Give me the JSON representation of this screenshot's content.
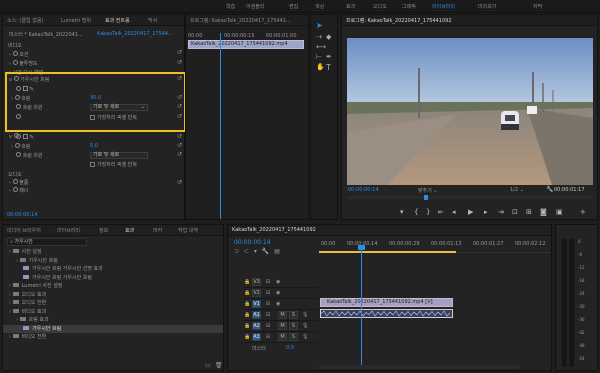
{
  "menu": {
    "items": [
      "학습",
      "어셈블리",
      "편집",
      "색상",
      "효과",
      "오디오",
      "그래픽",
      "라이브러리",
      "미리보기",
      "자막"
    ],
    "active_index": 7
  },
  "effects_panel": {
    "tabs": [
      "소스: (클립 없음)",
      "Lumetri 범위",
      "효과 컨트롤",
      "믹서"
    ],
    "active_tab": 2,
    "clip_label": "마스터 * KakaoTalk_2022041...",
    "clip_name": "KakaoTalk_20220417_17544...",
    "timecode": "00:00:00:14",
    "sections": [
      {
        "label": "비디오"
      },
      {
        "label": "모션"
      },
      {
        "label": "불투명도"
      },
      {
        "label": "시간 다시 매핑"
      }
    ],
    "gaussian": {
      "title": "가우시안 흐림",
      "blur_label": "흐림",
      "blur_value": "30.0",
      "dim_label": "흐림 차원",
      "dim_value": "가로 및 세로",
      "repeat_label": "가장자리 픽셀 반복"
    },
    "mosaic": {
      "blur_label": "흐림",
      "blur_value": "0.0",
      "dim_label": "흐림 차원",
      "dim_value": "가로 및 세로",
      "repeat_label": "가장자리 픽셀 반복"
    },
    "audio_section": "오디오",
    "audio_items": [
      "볼륨",
      "패너"
    ]
  },
  "source_panel": {
    "tab": "프로그램: KakaoTalk_20220417_175441...",
    "ruler": [
      "00:00",
      "00:00:00:15",
      "00:00:01:00"
    ],
    "clip": "KakaoTalk_20220417_175441092.mp4"
  },
  "program": {
    "tab": "프로그램: KakaoTalk_20220417_175441092",
    "timecode_left": "00:00:00:14",
    "fit": "맞추기",
    "quality": "1/2",
    "timecode_right": "00:00:01:17"
  },
  "project_panel": {
    "tabs": [
      "미디어 브라우저",
      "라이브러리",
      "정보",
      "효과",
      "마커",
      "작업 내역"
    ],
    "active_tab": 3,
    "search_placeholder": "가우시안",
    "tree": [
      {
        "label": "사전 설정",
        "indent": 0,
        "icon": "folder"
      },
      {
        "label": "가우시안 흐림",
        "indent": 1,
        "icon": "folder"
      },
      {
        "label": "가우시안 흐림 가우시안 선명 효과",
        "indent": 2,
        "icon": "effect"
      },
      {
        "label": "가우시안 흐림 가우시안 흐림",
        "indent": 2,
        "icon": "effect"
      },
      {
        "label": "Lumetri 사전 설정",
        "indent": 0,
        "icon": "folder"
      },
      {
        "label": "오디오 효과",
        "indent": 0,
        "icon": "folder"
      },
      {
        "label": "오디오 전환",
        "indent": 0,
        "icon": "folder"
      },
      {
        "label": "비디오 효과",
        "indent": 0,
        "icon": "folder"
      },
      {
        "label": "흐림 효과",
        "indent": 1,
        "icon": "folder"
      },
      {
        "label": "가우시안 흐림",
        "indent": 2,
        "icon": "effect",
        "selected": true
      },
      {
        "label": "비디오 전환",
        "indent": 0,
        "icon": "folder"
      }
    ]
  },
  "timeline": {
    "tab": "KakaoTalk_20220417_175441092",
    "timecode": "00:00:00:14",
    "ruler": [
      "00:00",
      "00:00:00:14",
      "00:00:00:29",
      "00:00:01:13",
      "00:00:01:27",
      "00:00:02:12"
    ],
    "video_tracks": [
      "V3",
      "V2",
      "V1"
    ],
    "audio_tracks": [
      "A1",
      "A2",
      "A3"
    ],
    "master": "마스터",
    "master_value": "0.0",
    "video_clip": "KakaoTalk_20220417_175441092.mp4 [V]"
  },
  "meter": {
    "ticks": [
      "0",
      "-6",
      "-12",
      "-18",
      "-24",
      "-30",
      "-36",
      "-42",
      "-48",
      "-54"
    ]
  },
  "colors": {
    "accent": "#2d8ceb",
    "highlight_box": "#f0c020",
    "clip_video": "#a89ec0",
    "clip_audio": "#3a3f60"
  }
}
